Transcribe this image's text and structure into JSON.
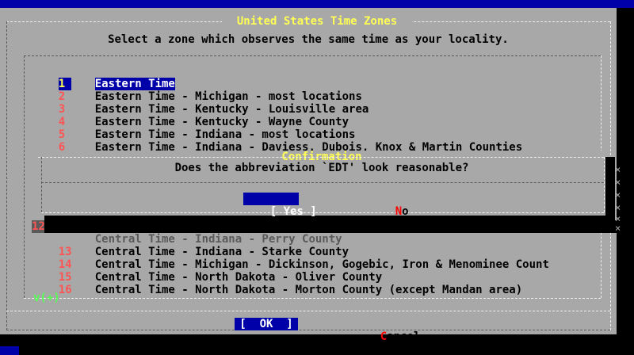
{
  "window": {
    "title": " United States Time Zones ",
    "prompt": "Select a zone which observes the same time as your locality."
  },
  "zones": [
    {
      "tag": "1",
      "label": "Eastern Time"
    },
    {
      "tag": "2",
      "label": "Eastern Time - Michigan - most locations"
    },
    {
      "tag": "3",
      "label": "Eastern Time - Kentucky - Louisville area"
    },
    {
      "tag": "4",
      "label": "Eastern Time - Kentucky - Wayne County"
    },
    {
      "tag": "5",
      "label": "Eastern Time - Indiana - most locations"
    },
    {
      "tag": "6",
      "label": "Eastern Time - Indiana - Daviess, Dubois, Knox & Martin Counties"
    },
    {
      "tag": "12",
      "label": "Central Time - Indiana - Perry County"
    },
    {
      "tag": "13",
      "label": "Central Time - Indiana - Starke County"
    },
    {
      "tag": "14",
      "label": "Central Time - Michigan - Dickinson, Gogebic, Iron & Menominee Count"
    },
    {
      "tag": "15",
      "label": "Central Time - North Dakota - Oliver County"
    },
    {
      "tag": "16",
      "label": "Central Time - North Dakota - Morton County (except Mandan area)"
    }
  ],
  "scroll_indicator": "v(+)",
  "dialog": {
    "title": " Confirmation ",
    "question": "Does the abbreviation `EDT' look reasonable?",
    "yes_left": "[ ",
    "yes_hot": "Y",
    "yes_rest": "es ]",
    "no_hot": "N",
    "no_rest": "o"
  },
  "buttons": {
    "ok_label": "[  OK  ]",
    "cancel_hot": "C",
    "cancel_rest": "ancel"
  },
  "side_marks": [
    "×",
    "×",
    "×",
    "×",
    "×",
    "×"
  ],
  "colors": {
    "background": "#a8a8a8",
    "accent_blue": "#0000a8",
    "title_yellow": "#ffff54",
    "tag_red": "#ff5454"
  }
}
